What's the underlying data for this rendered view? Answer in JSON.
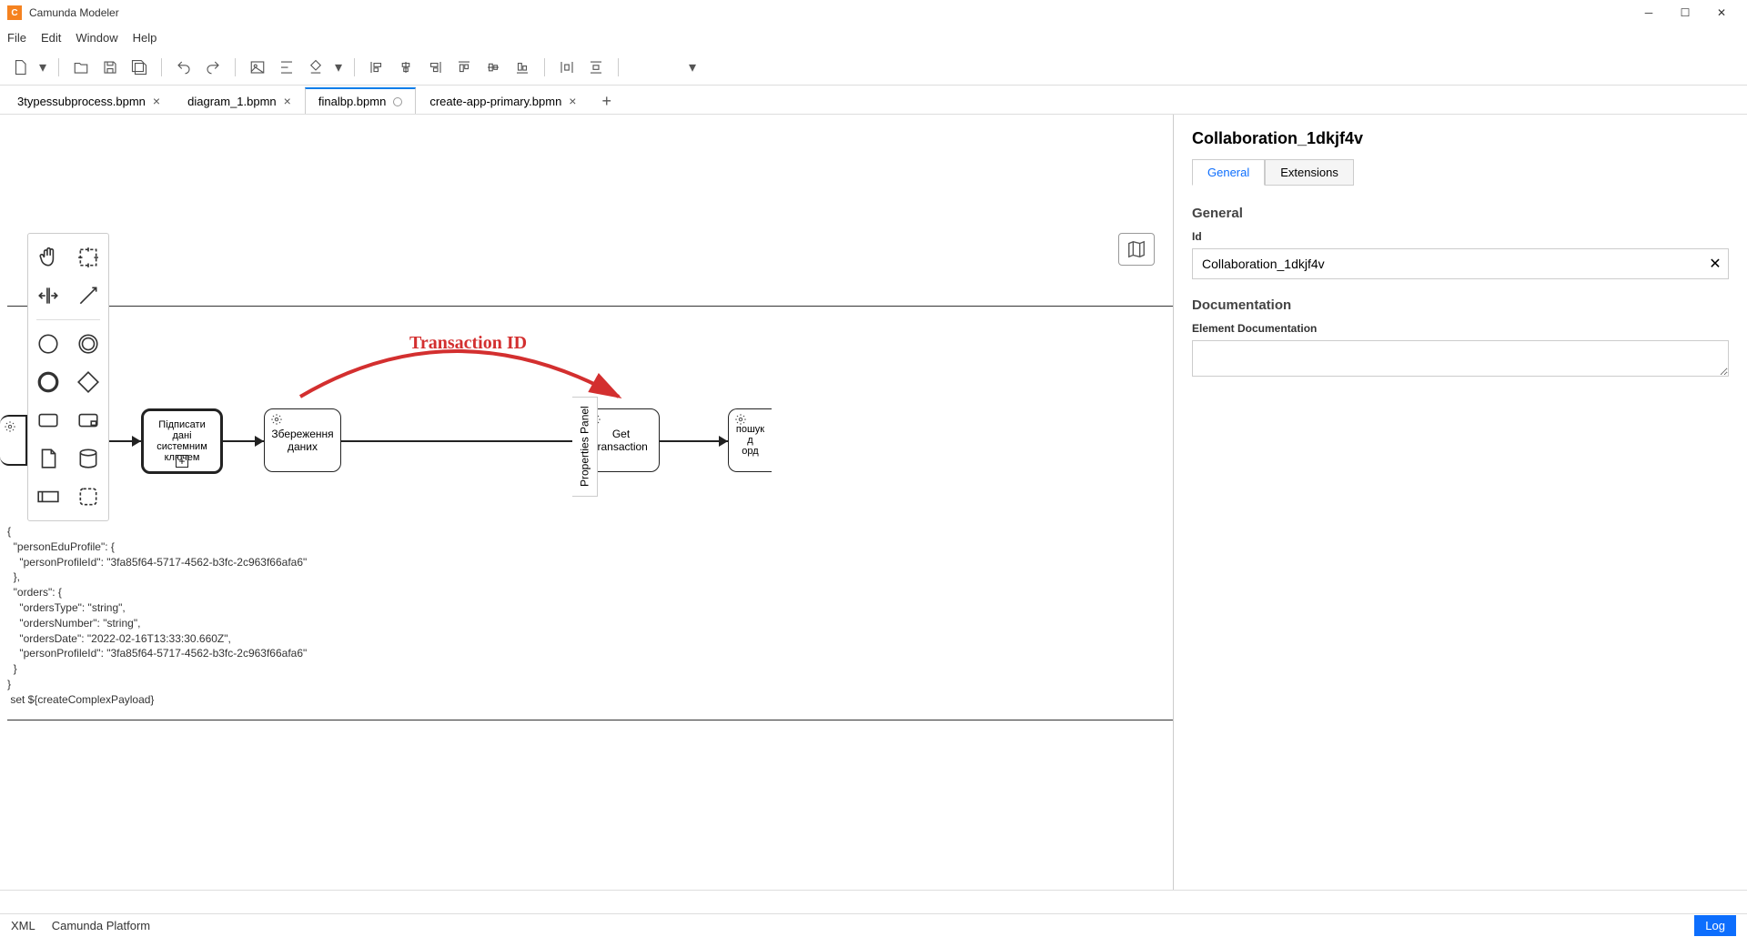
{
  "app": {
    "title": "Camunda Modeler"
  },
  "menu": {
    "file": "File",
    "edit": "Edit",
    "window": "Window",
    "help": "Help"
  },
  "tabs": [
    {
      "label": "3typessubprocess.bpmn",
      "dirty": false,
      "active": false
    },
    {
      "label": "diagram_1.bpmn",
      "dirty": false,
      "active": false
    },
    {
      "label": "finalbp.bpmn",
      "dirty": true,
      "active": true
    },
    {
      "label": "create-app-primary.bpmn",
      "dirty": false,
      "active": false
    }
  ],
  "diagram": {
    "annotation": "Transaction ID",
    "tasks": {
      "sign": "Підписати дані системним ключем",
      "save": "Збереження даних",
      "get": "Get transaction",
      "search": "пошук д\nорд"
    },
    "json_snippet": "{\n  \"personEduProfile\": {\n    \"personProfileId\": \"3fa85f64-5717-4562-b3fc-2c963f66afa6\"\n  },\n  \"orders\": {\n    \"ordersType\": \"string\",\n    \"ordersNumber\": \"string\",\n    \"ordersDate\": \"2022-02-16T13:33:30.660Z\",\n    \"personProfileId\": \"3fa85f64-5717-4562-b3fc-2c963f66afa6\"\n  }\n}\n set ${createComplexPayload}"
  },
  "properties": {
    "title": "Collaboration_1dkjf4v",
    "tabs": {
      "general": "General",
      "extensions": "Extensions"
    },
    "section_general": "General",
    "id_label": "Id",
    "id_value": "Collaboration_1dkjf4v",
    "section_doc": "Documentation",
    "doc_label": "Element Documentation",
    "doc_value": "",
    "toggle": "Properties Panel"
  },
  "status": {
    "xml": "XML",
    "platform": "Camunda Platform",
    "log": "Log"
  }
}
